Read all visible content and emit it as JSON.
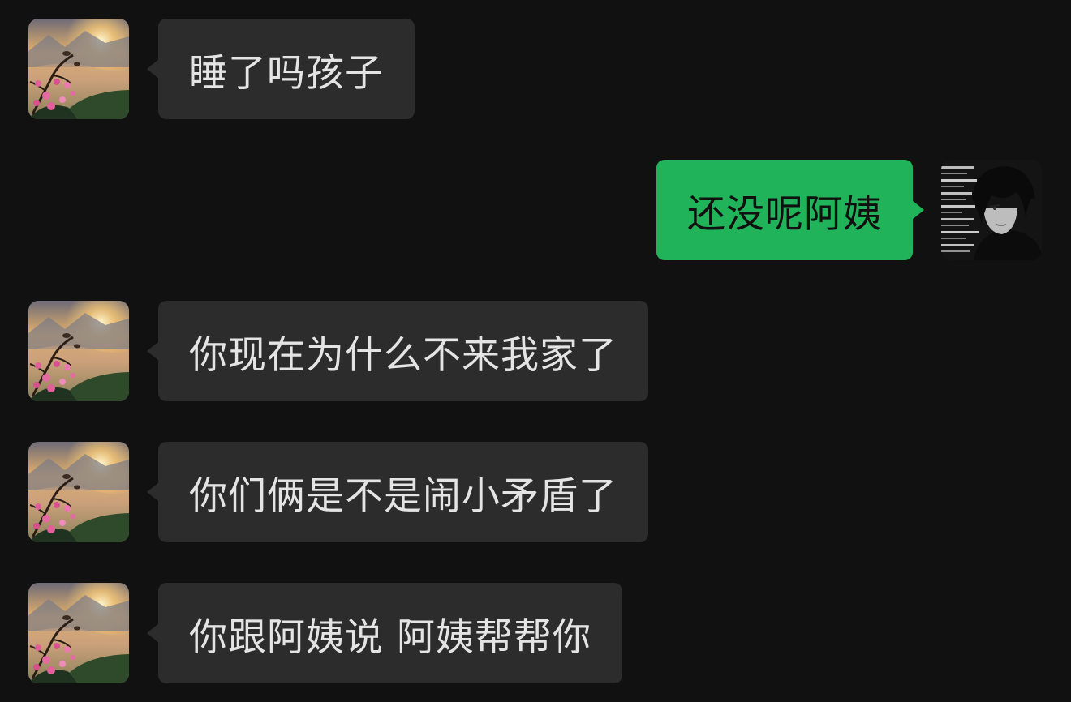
{
  "messages": [
    {
      "sender": "aunt",
      "text": "睡了吗孩子"
    },
    {
      "sender": "me",
      "text": "还没呢阿姨"
    },
    {
      "sender": "aunt",
      "text": "你现在为什么不来我家了"
    },
    {
      "sender": "aunt",
      "text": "你们俩是不是闹小矛盾了"
    },
    {
      "sender": "aunt",
      "text": "你跟阿姨说 阿姨帮帮你"
    }
  ],
  "avatars": {
    "aunt": "peach-blossom-sunrise-landscape",
    "me": "dark-anime-boy-portrait"
  },
  "colors": {
    "background": "#111111",
    "incoming_bubble": "#2c2c2c",
    "outgoing_bubble": "#21b35a",
    "incoming_text": "#e4e4e4",
    "outgoing_text": "#101010"
  }
}
